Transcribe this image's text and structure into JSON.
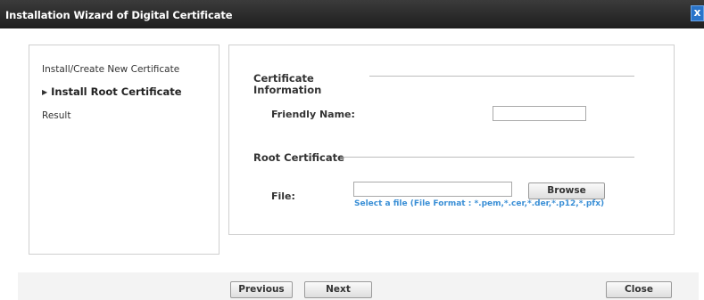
{
  "window": {
    "title": "Installation Wizard of Digital Certificate",
    "close_glyph": "x"
  },
  "steps": [
    {
      "label": "Install/Create New Certificate",
      "current": false
    },
    {
      "label": "Install Root Certificate",
      "current": true,
      "marker": "▶"
    },
    {
      "label": "Result",
      "current": false
    }
  ],
  "form": {
    "section_cert_info": "Certificate Information",
    "friendly_name_label": "Friendly Name:",
    "friendly_name_value": "",
    "section_root_cert": "Root Certificate",
    "file_label": "File:",
    "file_value": "",
    "browse_label": "Browse",
    "file_hint": "Select a file (File Format : *.pem,*.cer,*.der,*.p12,*.pfx)"
  },
  "footer": {
    "previous_label": "Previous",
    "next_label": "Next",
    "close_label": "Close"
  },
  "colors": {
    "titlebar": "#1e1e1e",
    "close_button": "#2a74c9",
    "hint_text": "#3a8fd6"
  }
}
